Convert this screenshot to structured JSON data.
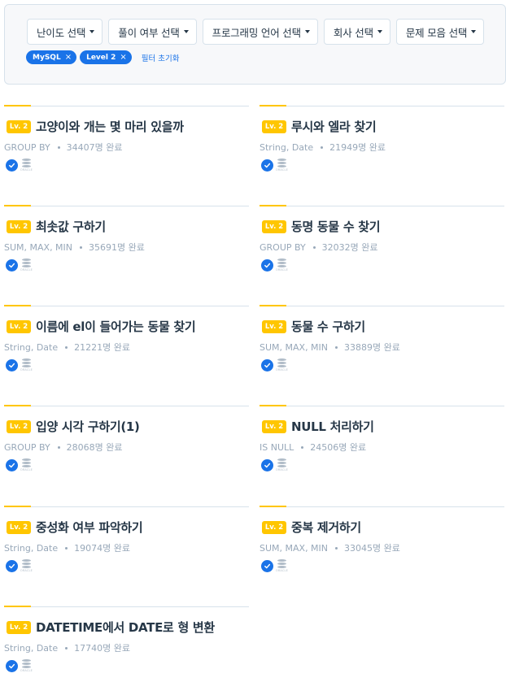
{
  "filters": {
    "dropdowns": [
      {
        "label": "난이도 선택"
      },
      {
        "label": "풀이 여부 선택"
      },
      {
        "label": "프로그래밍 언어 선택"
      },
      {
        "label": "회사 선택"
      },
      {
        "label": "문제 모음 선택"
      }
    ],
    "chips": [
      {
        "label": "MySQL",
        "remove": "×"
      },
      {
        "label": "Level 2",
        "remove": "×"
      }
    ],
    "reset_label": "필터 초기화"
  },
  "problems": [
    {
      "level": "Lv. 2",
      "title": "고양이와 개는 몇 마리 있을까",
      "tags": "GROUP BY",
      "solved": "34407명 완료",
      "db_label": "ORACLE"
    },
    {
      "level": "Lv. 2",
      "title": "루시와 엘라 찾기",
      "tags": "String, Date",
      "solved": "21949명 완료",
      "db_label": "ORACLE"
    },
    {
      "level": "Lv. 2",
      "title": "최솟값 구하기",
      "tags": "SUM, MAX, MIN",
      "solved": "35691명 완료",
      "db_label": "ORACLE"
    },
    {
      "level": "Lv. 2",
      "title": "동명 동물 수 찾기",
      "tags": "GROUP BY",
      "solved": "32032명 완료",
      "db_label": "ORACLE"
    },
    {
      "level": "Lv. 2",
      "title": "이름에 el이 들어가는 동물 찾기",
      "tags": "String, Date",
      "solved": "21221명 완료",
      "db_label": "ORACLE"
    },
    {
      "level": "Lv. 2",
      "title": "동물 수 구하기",
      "tags": "SUM, MAX, MIN",
      "solved": "33889명 완료",
      "db_label": "ORACLE"
    },
    {
      "level": "Lv. 2",
      "title": "입양 시각 구하기(1)",
      "tags": "GROUP BY",
      "solved": "28068명 완료",
      "db_label": "ORACLE"
    },
    {
      "level": "Lv. 2",
      "title": "NULL 처리하기",
      "tags": "IS NULL",
      "solved": "24506명 완료",
      "db_label": "ORACLE"
    },
    {
      "level": "Lv. 2",
      "title": "중성화 여부 파악하기",
      "tags": "String, Date",
      "solved": "19074명 완료",
      "db_label": "ORACLE"
    },
    {
      "level": "Lv. 2",
      "title": "중복 제거하기",
      "tags": "SUM, MAX, MIN",
      "solved": "33045명 완료",
      "db_label": "ORACLE"
    },
    {
      "level": "Lv. 2",
      "title": "DATETIME에서 DATE로 형 변환",
      "tags": "String, Date",
      "solved": "17740명 완료",
      "db_label": "ORACLE"
    }
  ],
  "colors": {
    "accent": "#1a73e8",
    "level_badge": "#ffc600",
    "meta_text": "#98a8b9"
  },
  "icons": {
    "check": "check-circle-icon",
    "database": "oracle-database-icon",
    "dropdown": "caret-down-icon",
    "remove": "close-icon"
  }
}
